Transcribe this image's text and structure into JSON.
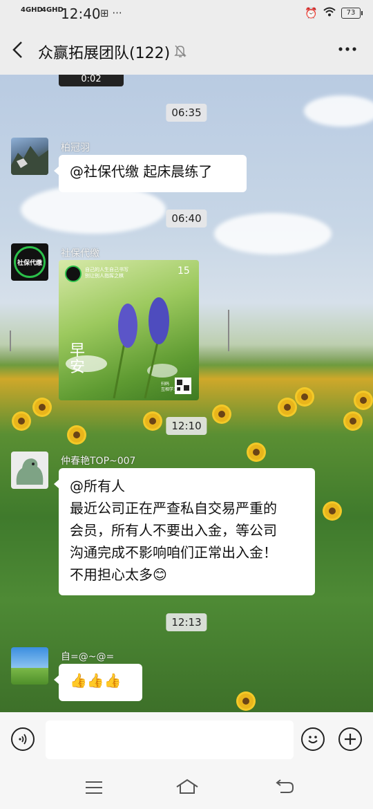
{
  "status_bar": {
    "network_left": "4GHD",
    "network_right": "4GHD",
    "time": "12:40",
    "extra": "⊞ ···",
    "battery": "73"
  },
  "header": {
    "title": "众赢拓展团队(122)",
    "back_icon": "chevron-left-icon",
    "mute_icon": "bell-off-icon",
    "more_icon": "more-icon"
  },
  "chat": {
    "video_duration": "0:02",
    "messages": [
      {
        "type": "time",
        "text": "06:35"
      },
      {
        "type": "text",
        "sender": "柏冠羽",
        "text": "@社保代缴  起床晨练了"
      },
      {
        "type": "time",
        "text": "06:40"
      },
      {
        "type": "image",
        "sender": "社保代缴",
        "avatar_text": "社保代缴",
        "image_text": {
          "header": "自己的人生自己书写\n别让别人指挥之棋",
          "date": "15",
          "big": "早\n安",
          "small": "扫码\n互相学习"
        }
      },
      {
        "type": "time",
        "text": "12:10"
      },
      {
        "type": "text",
        "sender": "仲春艳TOP~007",
        "lines": [
          "@所有人",
          "最近公司正在严查私自交易严重的",
          "会员，所有人不要出入金，等公司",
          "沟通完成不影响咱们正常出入金！",
          "不用担心太多😊"
        ]
      },
      {
        "type": "time",
        "text": "12:13"
      },
      {
        "type": "text",
        "sender": "自=@~@=",
        "text": "👍👍👍"
      }
    ]
  },
  "input_bar": {
    "voice_icon": "voice-icon",
    "emoji_icon": "emoji-icon",
    "plus_icon": "plus-icon",
    "placeholder": ""
  },
  "nav_bar": {
    "menu_icon": "menu-icon",
    "home_icon": "home-icon",
    "back_icon": "back-icon"
  }
}
